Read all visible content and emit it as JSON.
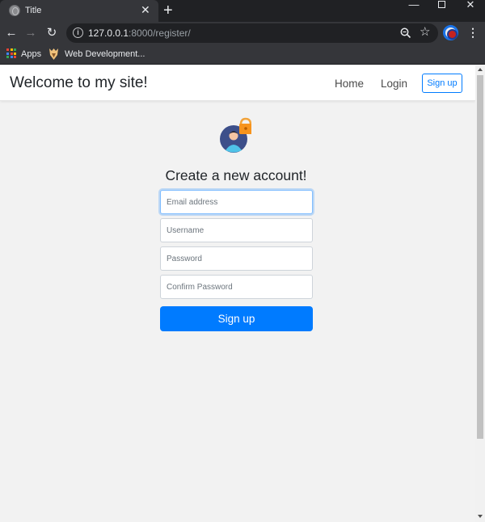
{
  "browser": {
    "tab_title": "Title",
    "tab_close": "✕",
    "new_tab": "+",
    "url_host": "127.0.0.1",
    "url_rest": ":8000/register/",
    "bookmarks": [
      {
        "label": "Apps"
      },
      {
        "label": "Web Development..."
      }
    ],
    "colors": {
      "frame": "#202124",
      "toolbar": "#35363a",
      "text": "#e8eaed"
    }
  },
  "site": {
    "brand": "Welcome to my site!",
    "nav": {
      "home": "Home",
      "login": "Login",
      "signup": "Sign up"
    }
  },
  "form": {
    "title": "Create a new account!",
    "email_placeholder": "Email address",
    "username_placeholder": "Username",
    "password_placeholder": "Password",
    "confirm_placeholder": "Confirm Password",
    "submit_label": "Sign up",
    "colors": {
      "accent": "#007bff",
      "page_bg": "#f2f2f2"
    }
  },
  "icons": [
    "globe-icon",
    "close-icon",
    "plus-icon",
    "back-arrow-icon",
    "forward-arrow-icon",
    "reload-icon",
    "info-icon",
    "zoom-icon",
    "star-icon",
    "profile-icon",
    "menu-icon",
    "apps-grid-icon",
    "user-lock-avatar-icon"
  ]
}
